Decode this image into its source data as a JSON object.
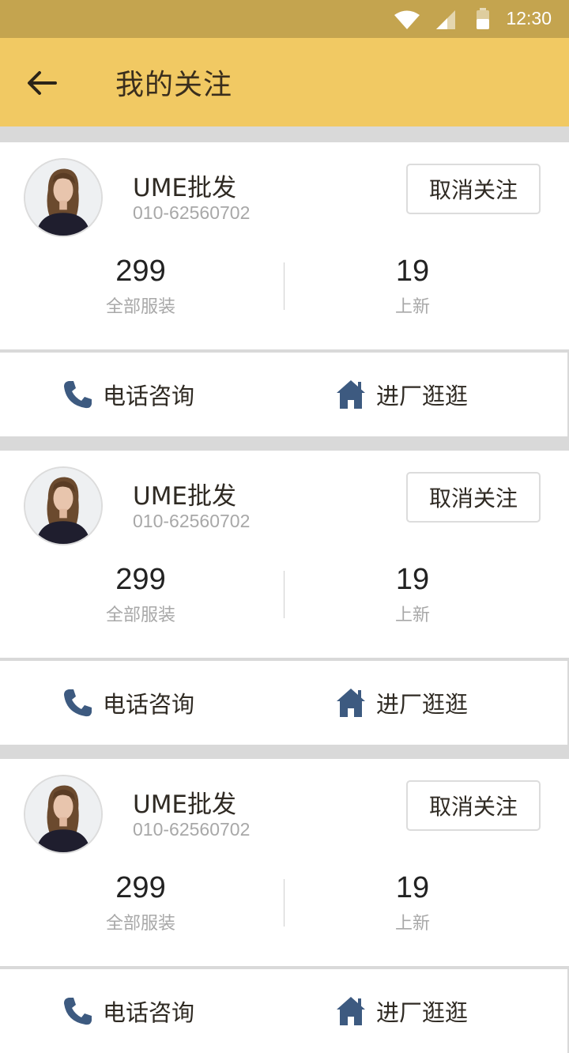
{
  "status_bar": {
    "time": "12:30"
  },
  "header": {
    "title": "我的关注"
  },
  "colors": {
    "header_bg": "#f1c963",
    "status_bg": "#c4a44f",
    "icon_blue": "#3d5a80"
  },
  "cards": [
    {
      "shop_name": "UME批发",
      "phone": "010-62560702",
      "unfollow_label": "取消关注",
      "stats": [
        {
          "value": "299",
          "label": "全部服装"
        },
        {
          "value": "19",
          "label": "上新"
        }
      ],
      "actions": {
        "call_label": "电话咨询",
        "visit_label": "进厂逛逛"
      }
    },
    {
      "shop_name": "UME批发",
      "phone": "010-62560702",
      "unfollow_label": "取消关注",
      "stats": [
        {
          "value": "299",
          "label": "全部服装"
        },
        {
          "value": "19",
          "label": "上新"
        }
      ],
      "actions": {
        "call_label": "电话咨询",
        "visit_label": "进厂逛逛"
      }
    },
    {
      "shop_name": "UME批发",
      "phone": "010-62560702",
      "unfollow_label": "取消关注",
      "stats": [
        {
          "value": "299",
          "label": "全部服装"
        },
        {
          "value": "19",
          "label": "上新"
        }
      ],
      "actions": {
        "call_label": "电话咨询",
        "visit_label": "进厂逛逛"
      }
    }
  ]
}
